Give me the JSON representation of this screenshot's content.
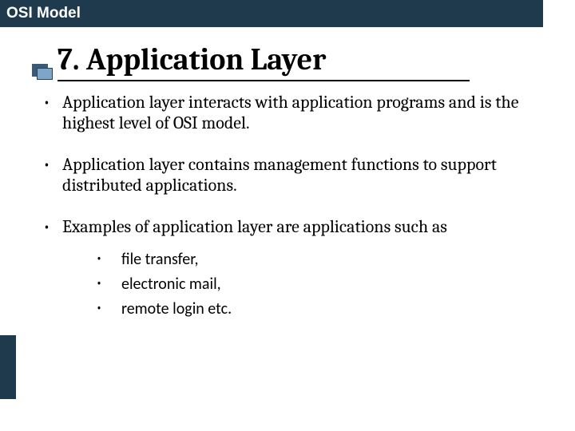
{
  "header": {
    "label": "OSI Model"
  },
  "title": "7. Application Layer",
  "bullets": [
    "Application layer interacts with application programs and is the highest level of OSI model.",
    "Application layer contains management functions to support distributed applications.",
    "Examples of application layer are applications such as"
  ],
  "sub_bullets": [
    "file transfer,",
    "electronic mail,",
    "remote login etc."
  ]
}
